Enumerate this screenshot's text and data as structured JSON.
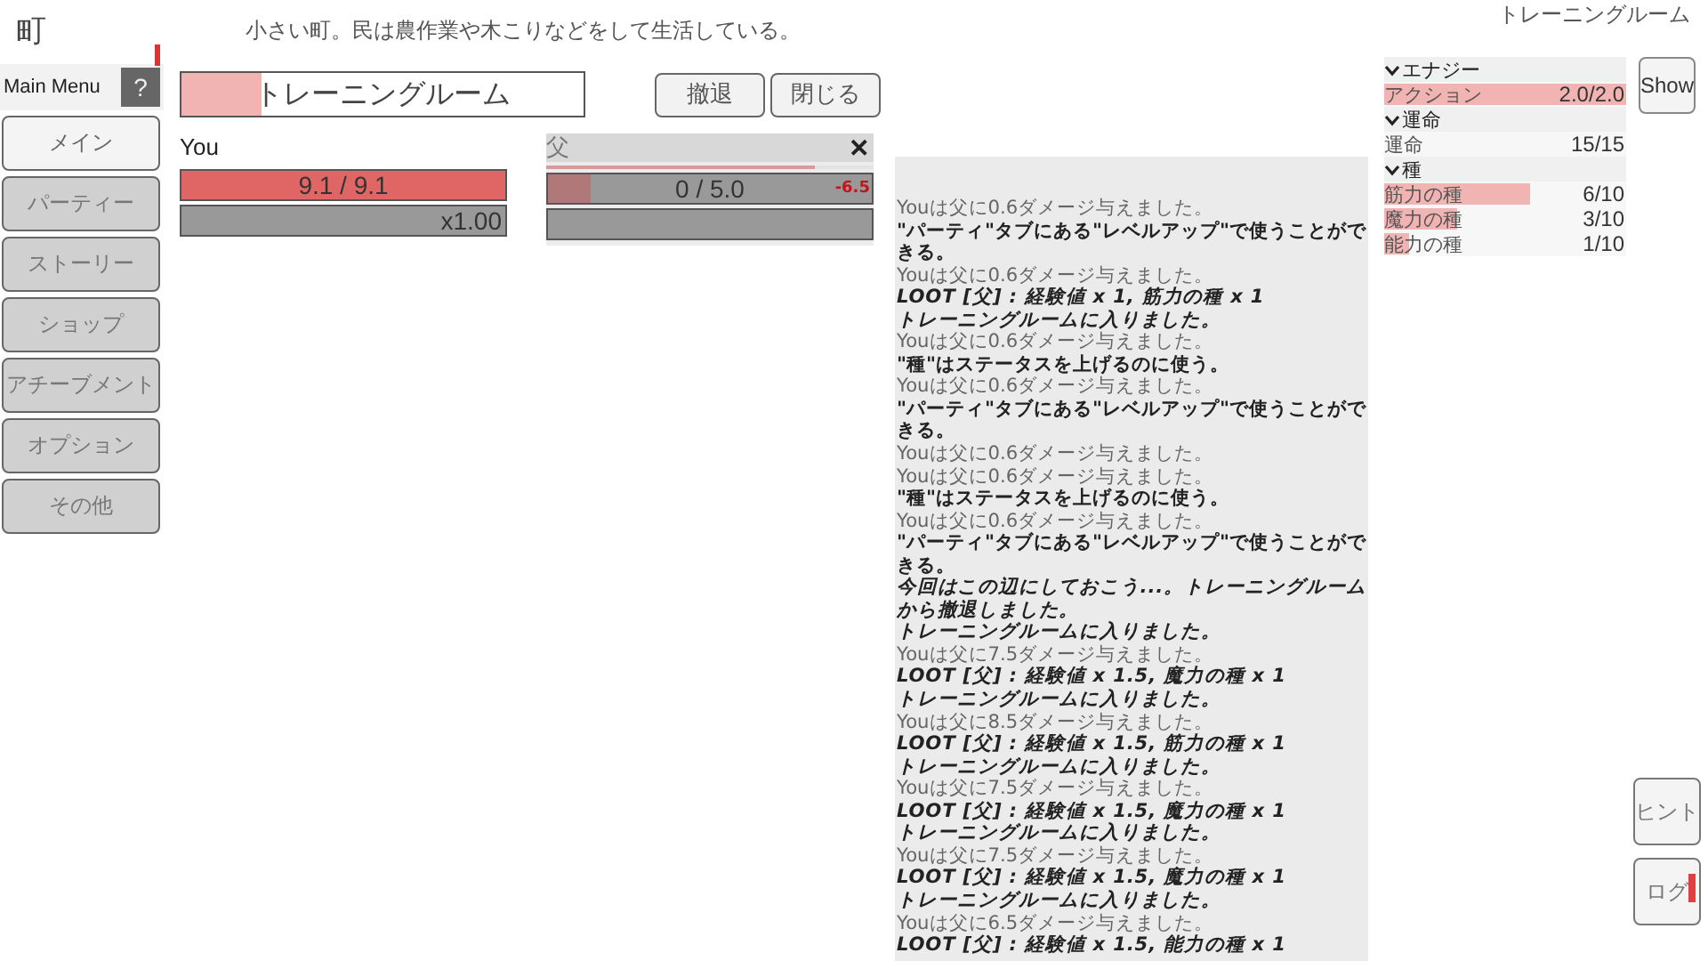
{
  "location": {
    "title": "町",
    "description": "小さい町。民は農作業や木こりなどをして生活している。",
    "area": "トレーニングルーム"
  },
  "menu": {
    "label": "Main Menu",
    "help": "?",
    "help_alert": true,
    "items": [
      {
        "label": "メイン",
        "selected": true
      },
      {
        "label": "パーティー",
        "selected": false
      },
      {
        "label": "ストーリー",
        "selected": false
      },
      {
        "label": "ショップ",
        "selected": false
      },
      {
        "label": "アチーブメント",
        "selected": false
      },
      {
        "label": "オプション",
        "selected": false
      },
      {
        "label": "その他",
        "selected": false
      }
    ]
  },
  "dungeon": {
    "name": "トレーニングルーム",
    "level": 0.2,
    "buttons": [
      "撤退",
      "閉じる"
    ]
  },
  "player": {
    "name": "You",
    "hp": "9.1 / 9.1",
    "level": 1.0,
    "speed": "x1.00"
  },
  "enemy": {
    "name": "父",
    "close": "✕",
    "timer": {
      "level": 0.82
    },
    "hp": "0 / 5.0",
    "level": 0.13,
    "damage": "-6.5"
  },
  "log": [
    {
      "kind": "damage",
      "text": "Youは父に0.6ダメージ与えました。"
    },
    {
      "kind": "tip",
      "text": "\"パーティ\"タブにある\"レベルアップ\"で使うことができる。"
    },
    {
      "kind": "damage",
      "text": "Youは父に0.6ダメージ与えました。"
    },
    {
      "kind": "loot",
      "text": "LOOT [父] : 経験値 x 1, 筋力の種 x 1"
    },
    {
      "kind": "event",
      "text": "トレーニングルームに入りました。"
    },
    {
      "kind": "damage",
      "text": "Youは父に0.6ダメージ与えました。"
    },
    {
      "kind": "tip",
      "text": "\"種\"はステータスを上げるのに使う。"
    },
    {
      "kind": "damage",
      "text": "Youは父に0.6ダメージ与えました。"
    },
    {
      "kind": "tip",
      "text": "\"パーティ\"タブにある\"レベルアップ\"で使うことができる。"
    },
    {
      "kind": "damage",
      "text": "Youは父に0.6ダメージ与えました。"
    },
    {
      "kind": "damage",
      "text": "Youは父に0.6ダメージ与えました。"
    },
    {
      "kind": "tip",
      "text": "\"種\"はステータスを上げるのに使う。"
    },
    {
      "kind": "damage",
      "text": "Youは父に0.6ダメージ与えました。"
    },
    {
      "kind": "tip",
      "text": "\"パーティ\"タブにある\"レベルアップ\"で使うことができる。"
    },
    {
      "kind": "event",
      "text": "今回はこの辺にしておこう...。トレーニングルームから撤退しました。"
    },
    {
      "kind": "event",
      "text": "トレーニングルームに入りました。"
    },
    {
      "kind": "damage",
      "text": "Youは父に7.5ダメージ与えました。"
    },
    {
      "kind": "loot",
      "text": "LOOT [父] : 経験値 x 1.5, 魔力の種 x 1"
    },
    {
      "kind": "event",
      "text": "トレーニングルームに入りました。"
    },
    {
      "kind": "damage",
      "text": "Youは父に8.5ダメージ与えました。"
    },
    {
      "kind": "loot",
      "text": "LOOT [父] : 経験値 x 1.5, 筋力の種 x 1"
    },
    {
      "kind": "event",
      "text": "トレーニングルームに入りました。"
    },
    {
      "kind": "damage",
      "text": "Youは父に7.5ダメージ与えました。"
    },
    {
      "kind": "loot",
      "text": "LOOT [父] : 経験値 x 1.5, 魔力の種 x 1"
    },
    {
      "kind": "event",
      "text": "トレーニングルームに入りました。"
    },
    {
      "kind": "damage",
      "text": "Youは父に7.5ダメージ与えました。"
    },
    {
      "kind": "loot",
      "text": "LOOT [父] : 経験値 x 1.5, 魔力の種 x 1"
    },
    {
      "kind": "event",
      "text": "トレーニングルームに入りました。"
    },
    {
      "kind": "damage",
      "text": "Youは父に6.5ダメージ与えました。"
    },
    {
      "kind": "loot",
      "text": "LOOT [父] : 経験値 x 1.5, 能力の種 x 1"
    }
  ],
  "stats": {
    "show_button": "Show",
    "sections": [
      {
        "title": "エナジー",
        "expanded": true,
        "rows": [
          {
            "label": "アクション",
            "value": "2.0/2.0",
            "level": 1.0
          }
        ]
      },
      {
        "title": "運命",
        "expanded": true,
        "rows": [
          {
            "label": "運命",
            "value": "15/15"
          }
        ]
      },
      {
        "title": "種",
        "expanded": true,
        "rows": [
          {
            "label": "筋力の種",
            "value": "6/10",
            "level": 0.6
          },
          {
            "label": "魔力の種",
            "value": "3/10",
            "level": 0.3
          },
          {
            "label": "能力の種",
            "value": "1/10",
            "level": 0.1
          }
        ]
      }
    ]
  },
  "side_buttons": [
    {
      "label": "ヒント",
      "alert": false
    },
    {
      "label": "ログ",
      "alert": true
    }
  ]
}
